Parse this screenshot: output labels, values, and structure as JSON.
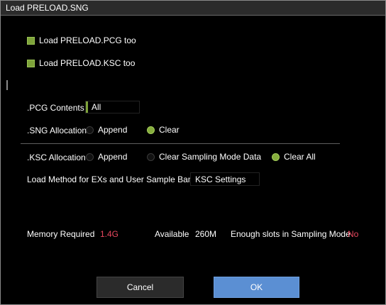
{
  "dialog": {
    "title": "Load PRELOAD.SNG",
    "load_pcg_checkbox": {
      "label": "Load PRELOAD.PCG too",
      "checked": true
    },
    "load_ksc_checkbox": {
      "label": "Load PRELOAD.KSC too",
      "checked": true
    },
    "pcg_contents": {
      "label": ".PCG Contents",
      "value": "All"
    },
    "sng_allocation": {
      "label": ".SNG Allocation",
      "options": [
        "Append",
        "Clear"
      ],
      "selected": "Clear"
    },
    "ksc_allocation": {
      "label": ".KSC Allocation",
      "options": [
        "Append",
        "Clear Sampling Mode Data",
        "Clear All"
      ],
      "selected": "Clear All"
    },
    "load_method": {
      "label": "Load Method for EXs and User Sample Banks",
      "value": "KSC Settings"
    },
    "memory": {
      "required_label": "Memory Required",
      "required_value": "1.4G",
      "available_label": "Available",
      "available_value": "260M",
      "slots_label": "Enough slots in Sampling Mode",
      "slots_value": "No"
    },
    "buttons": {
      "cancel": "Cancel",
      "ok": "OK"
    },
    "colors": {
      "accent_green": "#7ea33a",
      "ok_blue": "#5b8fd3",
      "warning_red": "#e8475e"
    }
  }
}
